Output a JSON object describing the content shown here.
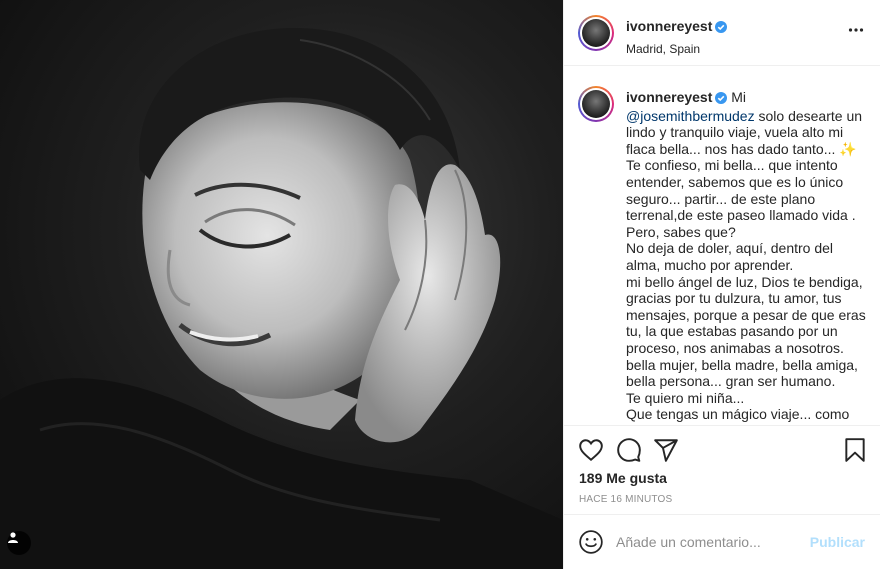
{
  "post": {
    "username": "ivonnereyest",
    "location": "Madrid, Spain",
    "caption": {
      "first_word": "Mi",
      "mention": "@josemithbermudez",
      "body": " solo desearte un lindo y tranquilo viaje, vuela alto mi flaca bella... nos has dado tanto... ✨\nTe confieso, mi bella... que intento entender, sabemos que es lo único seguro... partir... de este plano terrenal,de este paseo llamado vida .\nPero, sabes que?\nNo deja de doler, aquí, dentro del alma, mucho por aprender.\nmi bello ángel de luz, Dios te bendiga, gracias por tu dulzura, tu amor, tus mensajes, porque a pesar de que eras tu, la que estabas pasando por un proceso, nos animabas a nosotros.\nbella mujer, bella madre, bella amiga, bella persona... gran ser humano.\nTe quiero mi niña...\nQue tengas un mágico viaje... como tú."
    },
    "likes": "189 Me gusta",
    "timestamp": "HACE 16 MINUTOS"
  },
  "comment_box": {
    "placeholder": "Añade un comentario...",
    "post_label": "Publicar"
  },
  "icons": {
    "header_more": "more-dots-icon",
    "verified": "verified-badge-icon",
    "like": "heart-icon",
    "comment": "comment-bubble-icon",
    "share": "paper-plane-icon",
    "save": "bookmark-icon",
    "emoji": "smiley-icon",
    "user_tag": "user-tag-icon"
  },
  "colors": {
    "verified_blue": "#3897f0",
    "mention": "#00376b",
    "publish_disabled": "#b2dffc",
    "muted_text": "#8e8e8e"
  }
}
